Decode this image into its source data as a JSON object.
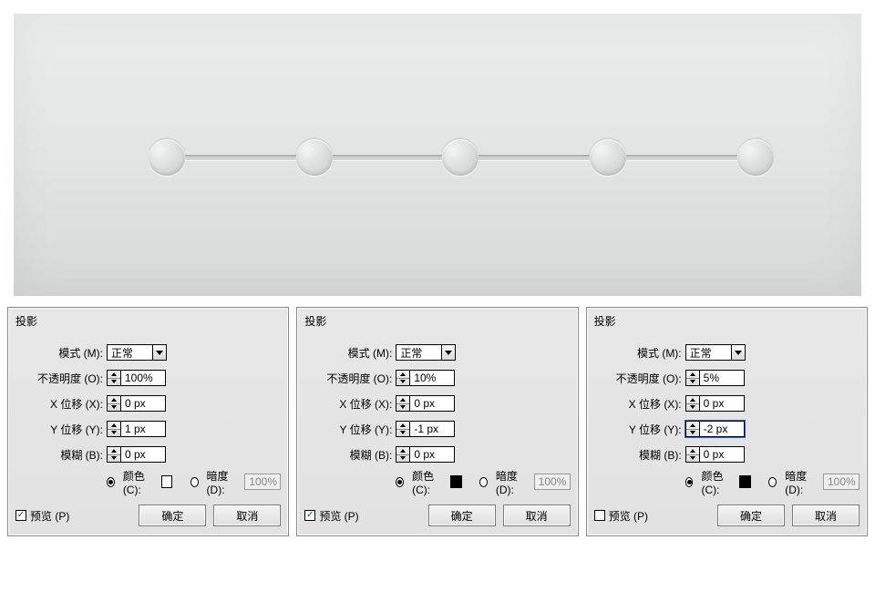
{
  "preview": {
    "dot_count": 5
  },
  "labels": {
    "title": "投影",
    "mode": "模式 (M):",
    "opacity": "不透明度 (O):",
    "xoffset": "X 位移 (X):",
    "yoffset": "Y 位移 (Y):",
    "blur": "模糊 (B):",
    "color": "颜色 (C):",
    "shade": "暗度 (D):",
    "preview": "预览 (P)",
    "ok": "确定",
    "cancel": "取消"
  },
  "dialogs": [
    {
      "mode": "正常",
      "opacity": "100%",
      "xoffset": "0 px",
      "yoffset": "1 px",
      "yoffset_focused": false,
      "blur": "0 px",
      "color_selected": true,
      "swatch": "#ffffff",
      "shade_selected": false,
      "shade_value": "100%",
      "preview_checked": true
    },
    {
      "mode": "正常",
      "opacity": "10%",
      "xoffset": "0 px",
      "yoffset": "-1 px",
      "yoffset_focused": false,
      "blur": "0 px",
      "color_selected": true,
      "swatch": "#000000",
      "shade_selected": false,
      "shade_value": "100%",
      "preview_checked": true
    },
    {
      "mode": "正常",
      "opacity": "5%",
      "xoffset": "0 px",
      "yoffset": "-2 px",
      "yoffset_focused": true,
      "blur": "0 px",
      "color_selected": true,
      "swatch": "#000000",
      "shade_selected": false,
      "shade_value": "100%",
      "preview_checked": false
    }
  ]
}
